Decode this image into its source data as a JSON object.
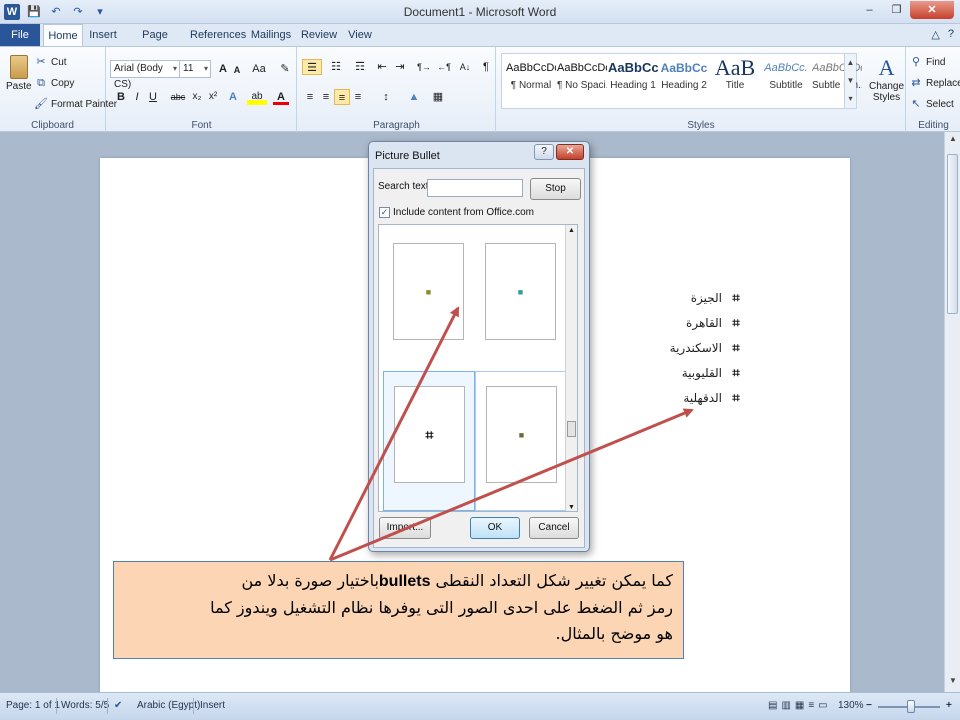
{
  "window": {
    "title": "Document1 - Microsoft Word",
    "minimize": "–",
    "restore": "❐",
    "close": "✕"
  },
  "qat": {
    "logo": "W",
    "save": "💾",
    "undo": "↶",
    "redo": "↷",
    "customize": "▾"
  },
  "tabs": [
    "File",
    "Home",
    "Insert",
    "Page Layout",
    "References",
    "Mailings",
    "Review",
    "View"
  ],
  "tab_right": {
    "help": "?",
    "collapse": "△"
  },
  "ribbon": {
    "clipboard": {
      "label": "Clipboard",
      "paste": "Paste",
      "cut": "Cut",
      "copy": "Copy",
      "format_painter": "Format Painter"
    },
    "font": {
      "label": "Font",
      "font_name": "Arial (Body CS)",
      "font_size": "11",
      "grow": "A",
      "shrink": "A",
      "change_case": "Aa",
      "clear": "✎",
      "bold": "B",
      "italic": "I",
      "underline": "U",
      "strike": "abc",
      "subscript": "x₂",
      "superscript": "x²",
      "text_effects": "A",
      "highlight": "ab",
      "font_color": "A"
    },
    "paragraph": {
      "label": "Paragraph",
      "bullets": "☰",
      "numbering": "☷",
      "multilevel": "☶",
      "decrease_indent": "⇤",
      "increase_indent": "⇥",
      "ltr": "¶→",
      "rtl": "←¶",
      "sort": "A↓",
      "pilcrow": "¶",
      "align_left": "≡",
      "center": "≡",
      "align_right": "≡",
      "justify": "≡",
      "line_spacing": "↕",
      "shading": "▲",
      "borders": "▦"
    },
    "styles": {
      "label": "Styles",
      "items": [
        {
          "sample": "AaBbCcDc",
          "name": "¶ Normal"
        },
        {
          "sample": "AaBbCcDc",
          "name": "¶ No Spaci..."
        },
        {
          "sample": "AaBbCc",
          "name": "Heading 1"
        },
        {
          "sample": "AaBbCc",
          "name": "Heading 2"
        },
        {
          "sample": "AaB",
          "name": "Title"
        },
        {
          "sample": "AaBbCc.",
          "name": "Subtitle"
        },
        {
          "sample": "AaBbCcDc",
          "name": "Subtle Em..."
        }
      ],
      "change_styles_line1": "Change",
      "change_styles_line2": "Styles"
    },
    "editing": {
      "label": "Editing",
      "find": "Find",
      "replace": "Replace",
      "select": "Select"
    }
  },
  "document": {
    "list_bullet": "⌗",
    "items": [
      "الجيزة",
      "القاهرة",
      "الاسكندرية",
      "القليوبية",
      "الدقهلية"
    ]
  },
  "dialog": {
    "title": "Picture Bullet",
    "help": "?",
    "close": "✕",
    "search_label": "Search text:",
    "search_value": "",
    "stop_button": "Stop",
    "include_label": "Include content from Office.com",
    "include_checked": "✓",
    "bullets": [
      "■",
      "■",
      "⌗",
      "■"
    ],
    "bullet_colors": [
      "#8a8a2a",
      "#2aa0a0",
      "#111111",
      "#6a6a3a"
    ],
    "import_button": "Import...",
    "ok_button": "OK",
    "cancel_button": "Cancel"
  },
  "callout": {
    "line1_pre": "كما يمكن تغيير شكل التعداد النقطى ",
    "bold": "bullets",
    "line1_post": "باختيار صورة بدلا من",
    "line2": "رمز ثم الضغط على احدى الصور التى يوفرها نظام التشغيل ويندوز كما",
    "line3": "هو موضح بالمثال."
  },
  "status": {
    "page": "Page: 1 of 1",
    "words": "Words: 5/5",
    "language": "Arabic (Egypt)",
    "mode": "Insert",
    "zoom": "130%",
    "zoom_minus": "−",
    "zoom_plus": "+"
  },
  "colors": {
    "accent": "#2b579a",
    "arrow": "#c0504d",
    "callout_bg": "#fcd5b4",
    "callout_border": "#4f81bd"
  }
}
